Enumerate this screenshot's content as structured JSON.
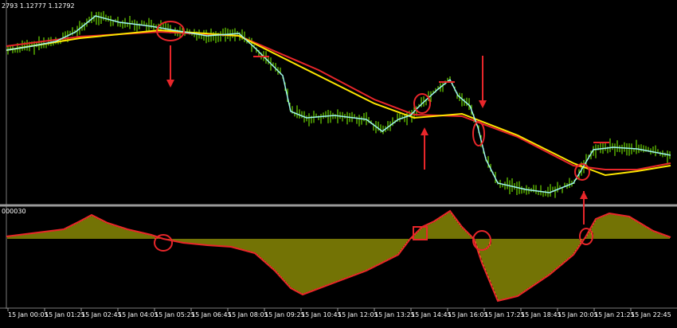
{
  "price_panel": {
    "header": "2793 1.12777 1.12792"
  },
  "osc_panel": {
    "header": "000030"
  },
  "time_axis": {
    "labels": [
      "15 Jan 00:05",
      "15 Jan 01:25",
      "15 Jan 02:45",
      "15 Jan 04:05",
      "15 Jan 05:25",
      "15 Jan 06:45",
      "15 Jan 08:05",
      "15 Jan 09:25",
      "15 Jan 10:45",
      "15 Jan 12:05",
      "15 Jan 13:25",
      "15 Jan 14:45",
      "15 Jan 16:05",
      "15 Jan 17:25",
      "15 Jan 18:45",
      "15 Jan 20:05",
      "15 Jan 21:25",
      "15 Jan 22:45"
    ]
  },
  "colors": {
    "background": "#000000",
    "price_bars": "#7fff00",
    "price_line": "#9ff5f0",
    "ma_fast": "#ffe600",
    "ma_slow": "#e8262a",
    "histogram": "#e6e60a",
    "annotation": "#e8262a",
    "separator": "#9a9a9a"
  },
  "annotations": {
    "circles": 7,
    "squares": 1,
    "down_arrows": 2,
    "up_arrows": 2
  }
}
